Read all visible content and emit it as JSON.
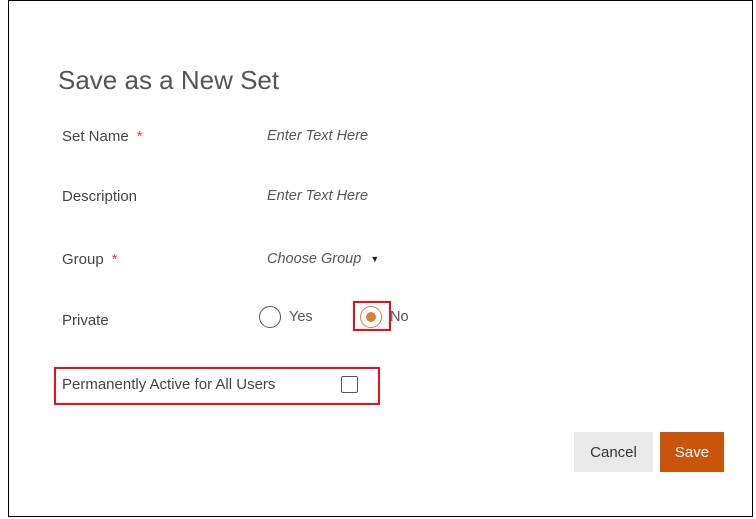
{
  "dialog": {
    "title": "Save as a New Set",
    "set_name": {
      "label": "Set Name",
      "required_marker": "*",
      "placeholder": "Enter Text Here",
      "value": ""
    },
    "description": {
      "label": "Description",
      "placeholder": "Enter Text Here",
      "value": ""
    },
    "group": {
      "label": "Group",
      "required_marker": "*",
      "selected": "Choose Group",
      "caret": "▼"
    },
    "private": {
      "label": "Private",
      "options": [
        {
          "label": "Yes",
          "checked": false
        },
        {
          "label": "No",
          "checked": true
        }
      ]
    },
    "permanently_active": {
      "label": "Permanently Active for All Users",
      "checked": false
    },
    "buttons": {
      "cancel": "Cancel",
      "save": "Save"
    }
  },
  "colors": {
    "accent": "#d9823b",
    "save_button": "#c9540c",
    "highlight": "#e8101c",
    "required": "#e53935"
  }
}
